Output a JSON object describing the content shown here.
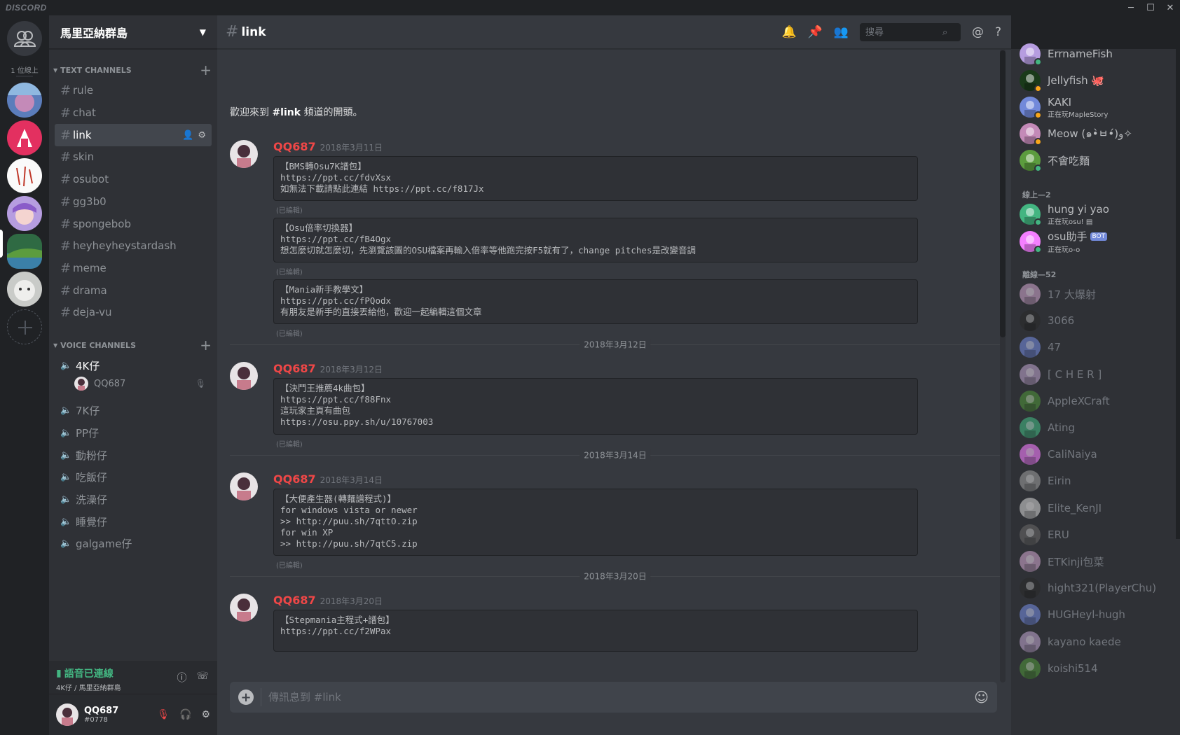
{
  "app": {
    "brand": "DISCORD"
  },
  "window": {
    "min": "─",
    "max": "☐",
    "close": "✕"
  },
  "servers": {
    "online_label": "1 位線上"
  },
  "guild": {
    "name": "馬里亞納群島"
  },
  "categories": {
    "text": "TEXT CHANNELS",
    "voice": "VOICE CHANNELS"
  },
  "text_channels": [
    "rule",
    "chat",
    "link",
    "skin",
    "osubot",
    "gg3b0",
    "spongebob",
    "heyheyheystardash",
    "meme",
    "drama",
    "deja-vu"
  ],
  "voice_channels": [
    "4K仔",
    "7K仔",
    "PP仔",
    "動粉仔",
    "吃飯仔",
    "洗澡仔",
    "睡覺仔",
    "galgame仔"
  ],
  "voice_user": "QQ687",
  "voice_panel": {
    "status": "語音已連線",
    "sub": "4K仔 / 馬里亞納群島"
  },
  "user_panel": {
    "name": "QQ687",
    "tag": "#0778"
  },
  "chat": {
    "channel": "link",
    "welcome_pre": "歡迎來到 ",
    "welcome_channel": "#link",
    "welcome_post": " 頻道的開頭。",
    "search_placeholder": "搜尋",
    "composer_placeholder": "傳訊息到 #link"
  },
  "messages": [
    {
      "author": "QQ687",
      "ts": "2018年3月11日"
    },
    {
      "author": "QQ687",
      "ts": "2018年3月12日"
    },
    {
      "author": "QQ687",
      "ts": "2018年3月14日"
    },
    {
      "author": "QQ687",
      "ts": "2018年3月20日"
    }
  ],
  "codeblocks": [
    "【BMS轉Osu7K譜包】\nhttps://ppt.cc/fdvXsx\n如無法下載請點此連結 https://ppt.cc/f817Jx",
    "【Osu倍率切換器】\nhttps://ppt.cc/fB4Ogx\n想怎麼切就怎麼切，先瀏覽該圖的OSU檔案再輸入倍率等他跑完按F5就有了，change pitches是改變音調",
    "【Mania新手教學文】\nhttps://ppt.cc/fPQodx\n有朋友是新手的直接丟給他，歡迎一起編輯這個文章",
    "【決鬥王推薦4k曲包】\nhttps://ppt.cc/f88Fnx\n這玩家主頁有曲包\nhttps://osu.ppy.sh/u/10767003",
    "【大便產生器(轉麵譜程式)】\nfor windows vista or newer\n>> http://puu.sh/7qttO.zip\nfor win XP\n>> http://puu.sh/7qtC5.zip",
    "【Stepmania主程式+譜包】\nhttps://ppt.cc/f2WPax"
  ],
  "edited_label": "(已編輯)",
  "dividers": [
    "2018年3月12日",
    "2018年3月14日",
    "2018年3月20日"
  ],
  "members": {
    "online": [
      {
        "name": "ErrnameFish",
        "activity": ""
      },
      {
        "name": "Jellyfish 🐙",
        "activity": ""
      },
      {
        "name": "KAKI",
        "activity": "正在玩MapleStory"
      },
      {
        "name": "Meow (๑•̀ㅂ•́)و✧",
        "activity": ""
      },
      {
        "name": "不會吃麵",
        "activity": ""
      }
    ],
    "group2_label": "線上—2",
    "group2": [
      {
        "name": "hung yi yao",
        "activity": "正在玩osu! ▤"
      },
      {
        "name": "osu助手",
        "activity": "正在玩o-o",
        "bot": "BOT"
      }
    ],
    "offline_label": "離線—52",
    "offline": [
      "17 大爆射",
      "3066",
      "47",
      "[ C H E R ]",
      "AppleXCraft",
      "Ating",
      "CaliNaiya",
      "Eirin",
      "Elite_KenJI",
      "ERU",
      "ETKinji包菜",
      "hight321(PlayerChu)",
      "HUGHeyl-hugh",
      "kayano kaede",
      "koishi514"
    ]
  },
  "colors": {
    "accent": "#7289da",
    "author": "#f04747",
    "online": "#43b581",
    "idle": "#faa61a"
  },
  "icons": [
    "bell-icon",
    "pin-icon",
    "members-icon",
    "search-icon",
    "mention-icon",
    "help-icon",
    "gear-icon",
    "add-user-icon",
    "speaker-icon",
    "mic-icon",
    "headphones-icon",
    "emoji-icon",
    "plus-icon",
    "info-icon",
    "disconnect-icon"
  ]
}
